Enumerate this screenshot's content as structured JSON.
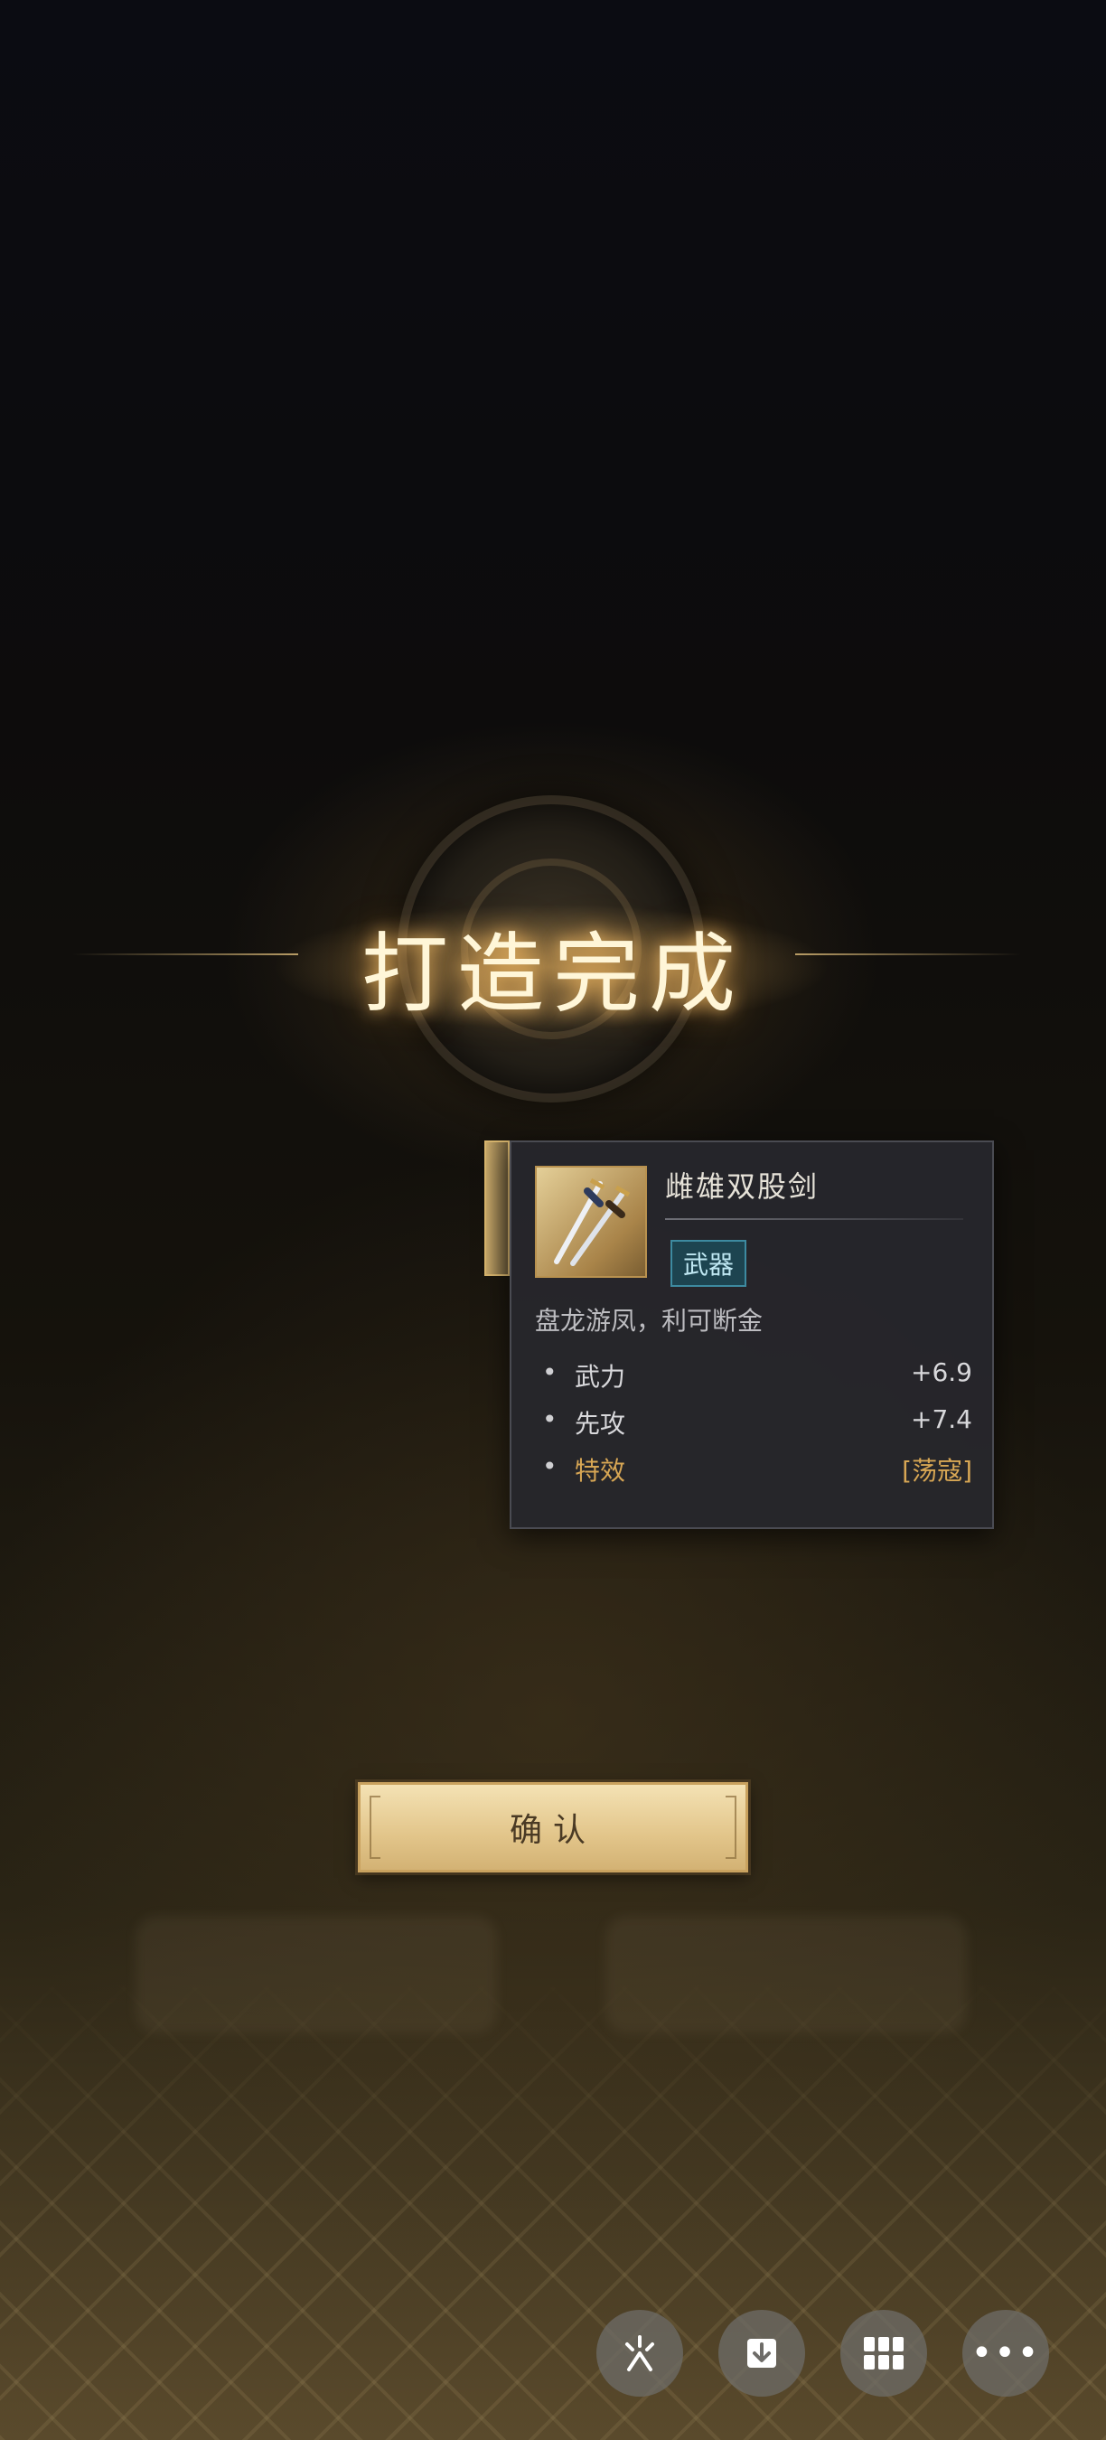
{
  "title": "打造完成",
  "item": {
    "name": "雌雄双股剑",
    "type": "武器",
    "description": "盘龙游凤，利可断金",
    "stats": [
      {
        "label": "武力",
        "value": "+6.9"
      },
      {
        "label": "先攻",
        "value": "+7.4"
      },
      {
        "label": "特效",
        "value": "[荡寇]"
      }
    ]
  },
  "confirm_label": "确认",
  "overlay_buttons": [
    {
      "icon": "sparkle-icon"
    },
    {
      "icon": "download-icon"
    },
    {
      "icon": "grid-icon"
    },
    {
      "icon": "more-icon"
    }
  ]
}
